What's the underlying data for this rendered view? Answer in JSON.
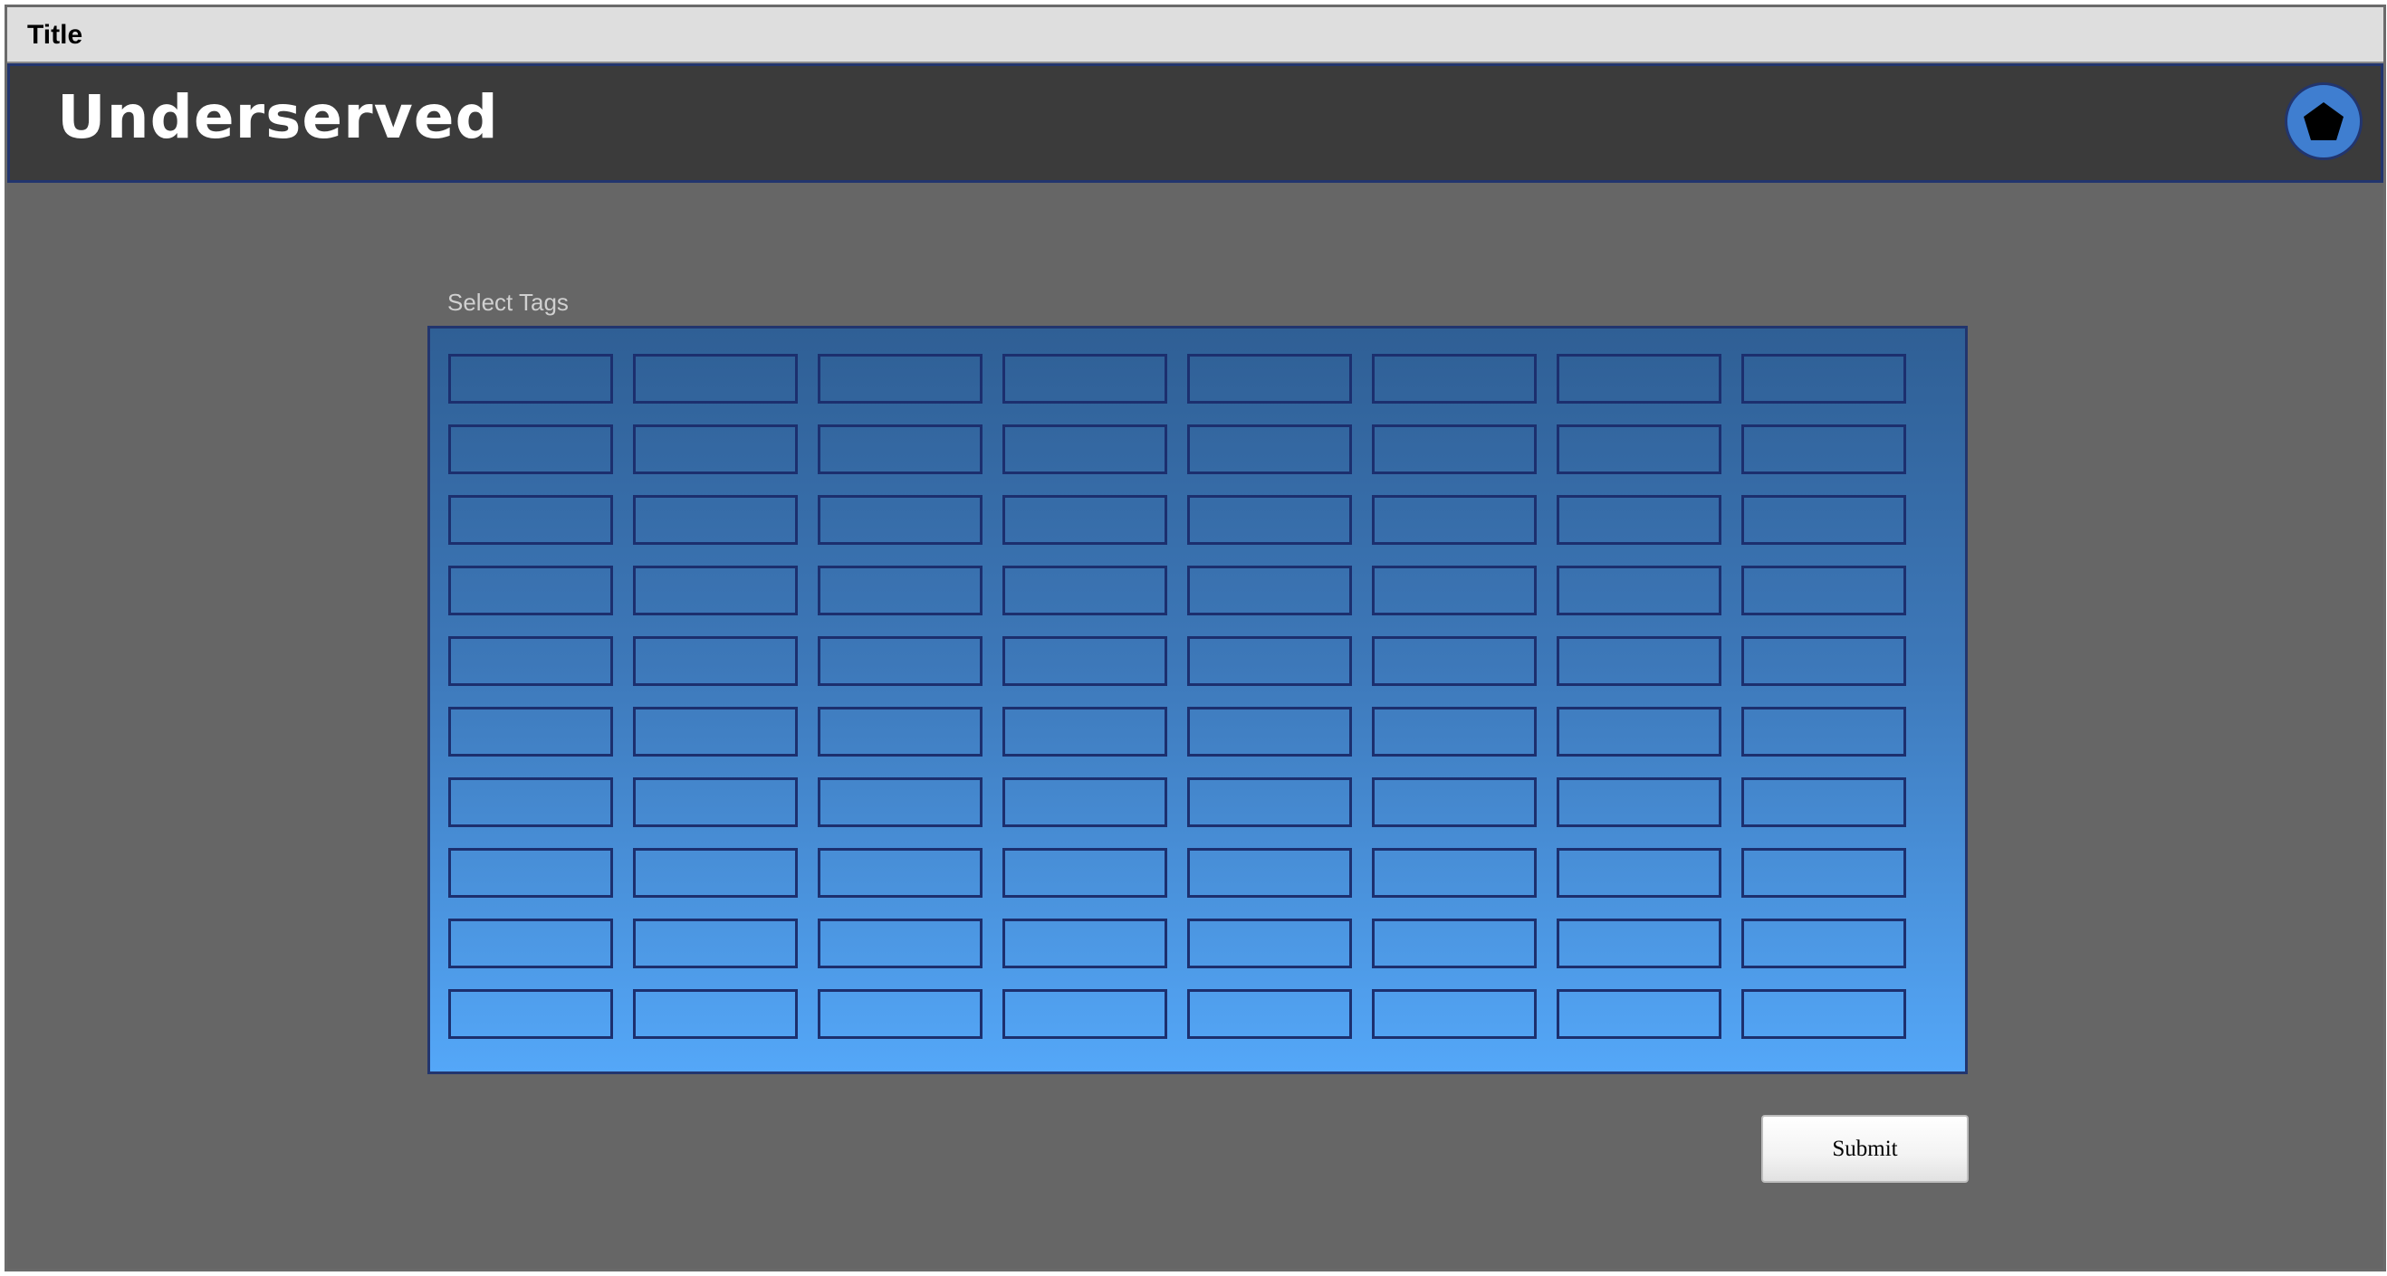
{
  "window": {
    "title": "Title"
  },
  "header": {
    "app_title": "Underserved",
    "avatar_icon": "pentagon-icon"
  },
  "tags": {
    "label": "Select Tags",
    "rows": 10,
    "columns": 8,
    "items": []
  },
  "actions": {
    "submit_label": "Submit"
  },
  "colors": {
    "page_background": "#666666",
    "header_background": "#3b3b3b",
    "accent_border": "#22356e",
    "panel_gradient_top": "#2f5f95",
    "panel_gradient_bottom": "#54a7f8",
    "avatar_fill": "#3f7ed0"
  }
}
